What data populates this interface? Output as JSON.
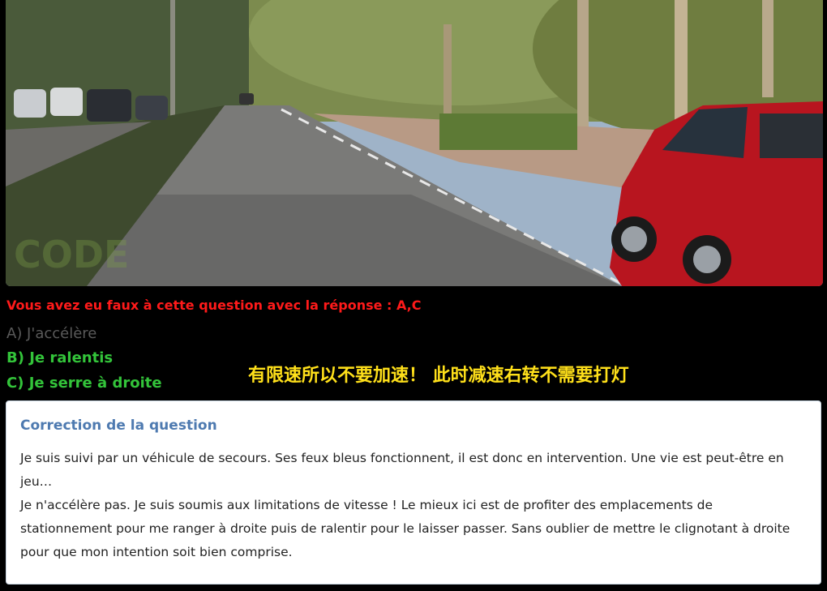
{
  "photo": {
    "alt": "road-scene",
    "watermark_text": "CODE"
  },
  "result_message": "Vous avez eu faux à cette question avec la réponse : A,C",
  "answers": [
    {
      "label": "A) J'accélère",
      "status": "wrong"
    },
    {
      "label": "B) Je ralentis",
      "status": "correct"
    },
    {
      "label": "C) Je serre à droite",
      "status": "correct"
    }
  ],
  "annotation_note": "有限速所以不要加速！ 此时减速右转不需要打灯",
  "correction": {
    "title": "Correction de la question",
    "paragraph1": "Je suis suivi par un véhicule de secours. Ses feux bleus fonctionnent, il est donc en intervention. Une vie est peut-être en jeu…",
    "paragraph2": "Je n'accélère pas. Je suis soumis aux limitations de vitesse ! Le mieux ici est de profiter des emplacements de stationnement pour me ranger à droite puis de ralentir pour le laisser passer. Sans oublier de mettre le clignotant à droite pour que mon intention soit bien comprise."
  },
  "colors": {
    "wrong_message": "#ff1a1a",
    "correct_answer": "#33c43a",
    "wrong_answer": "#5a5a5a",
    "note": "#ffe01a",
    "panel_title": "#4e7ab0"
  }
}
